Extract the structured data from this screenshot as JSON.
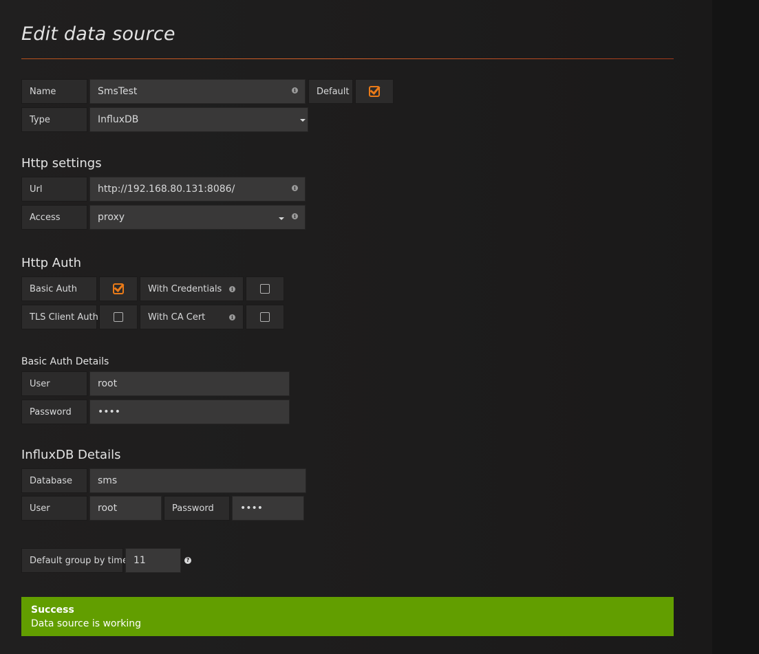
{
  "page": {
    "title": "Edit data source"
  },
  "general": {
    "name_label": "Name",
    "name_value": "SmsTest",
    "default_label": "Default",
    "default_checked": true,
    "type_label": "Type",
    "type_value": "InfluxDB"
  },
  "http_settings": {
    "title": "Http settings",
    "url_label": "Url",
    "url_value": "http://192.168.80.131:8086/",
    "access_label": "Access",
    "access_value": "proxy"
  },
  "http_auth": {
    "title": "Http Auth",
    "basic_auth_label": "Basic Auth",
    "basic_auth_checked": true,
    "with_credentials_label": "With Credentials",
    "with_credentials_checked": false,
    "tls_client_auth_label": "TLS Client Auth",
    "tls_client_auth_checked": false,
    "with_ca_cert_label": "With CA Cert",
    "with_ca_cert_checked": false
  },
  "basic_auth_details": {
    "title": "Basic Auth Details",
    "user_label": "User",
    "user_value": "root",
    "password_label": "Password",
    "password_value": "••••"
  },
  "influxdb_details": {
    "title": "InfluxDB Details",
    "database_label": "Database",
    "database_value": "sms",
    "user_label": "User",
    "user_value": "root",
    "password_label": "Password",
    "password_value": "••••"
  },
  "group_by": {
    "label": "Default group by time",
    "value": "11"
  },
  "alert": {
    "title": "Success",
    "message": "Data source is working"
  },
  "icons": {
    "info": "info-icon",
    "help": "question-circle-icon",
    "caret": "caret-down-icon",
    "check": "check-icon"
  },
  "colors": {
    "accent": "#eb7b18",
    "success": "#629e00",
    "title_rule": "#d6612a"
  }
}
